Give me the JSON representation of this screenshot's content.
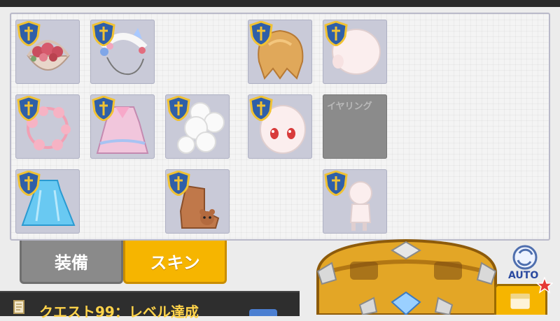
{
  "inventory": {
    "empty_slot_label": "イヤリング",
    "slots": [
      {
        "name": "flower-basket",
        "row": 0,
        "col": 0
      },
      {
        "name": "floral-headband",
        "row": 0,
        "col": 1
      },
      {
        "name": "blonde-hair",
        "row": 0,
        "col": 3
      },
      {
        "name": "head-back",
        "row": 0,
        "col": 4
      },
      {
        "name": "flower-wreath",
        "row": 1,
        "col": 0
      },
      {
        "name": "pink-dress",
        "row": 1,
        "col": 1
      },
      {
        "name": "cloud-accessory",
        "row": 1,
        "col": 2
      },
      {
        "name": "face-red-eyes",
        "row": 1,
        "col": 3
      },
      {
        "name": "earring-empty",
        "row": 1,
        "col": 4
      },
      {
        "name": "blue-cape",
        "row": 2,
        "col": 0
      },
      {
        "name": "bear-shoes",
        "row": 2,
        "col": 2
      },
      {
        "name": "body-base",
        "row": 2,
        "col": 4
      }
    ]
  },
  "tabs": {
    "equip_label": "装備",
    "skin_label": "スキン"
  },
  "quest": {
    "text": "クエスト99：レベル達成"
  },
  "auto": {
    "label": "AUTO"
  },
  "colors": {
    "accent": "#f6b500",
    "slot_bg": "#c9cad8",
    "empty_slot": "#8b8b8b",
    "quest_text": "#ffd34a"
  }
}
